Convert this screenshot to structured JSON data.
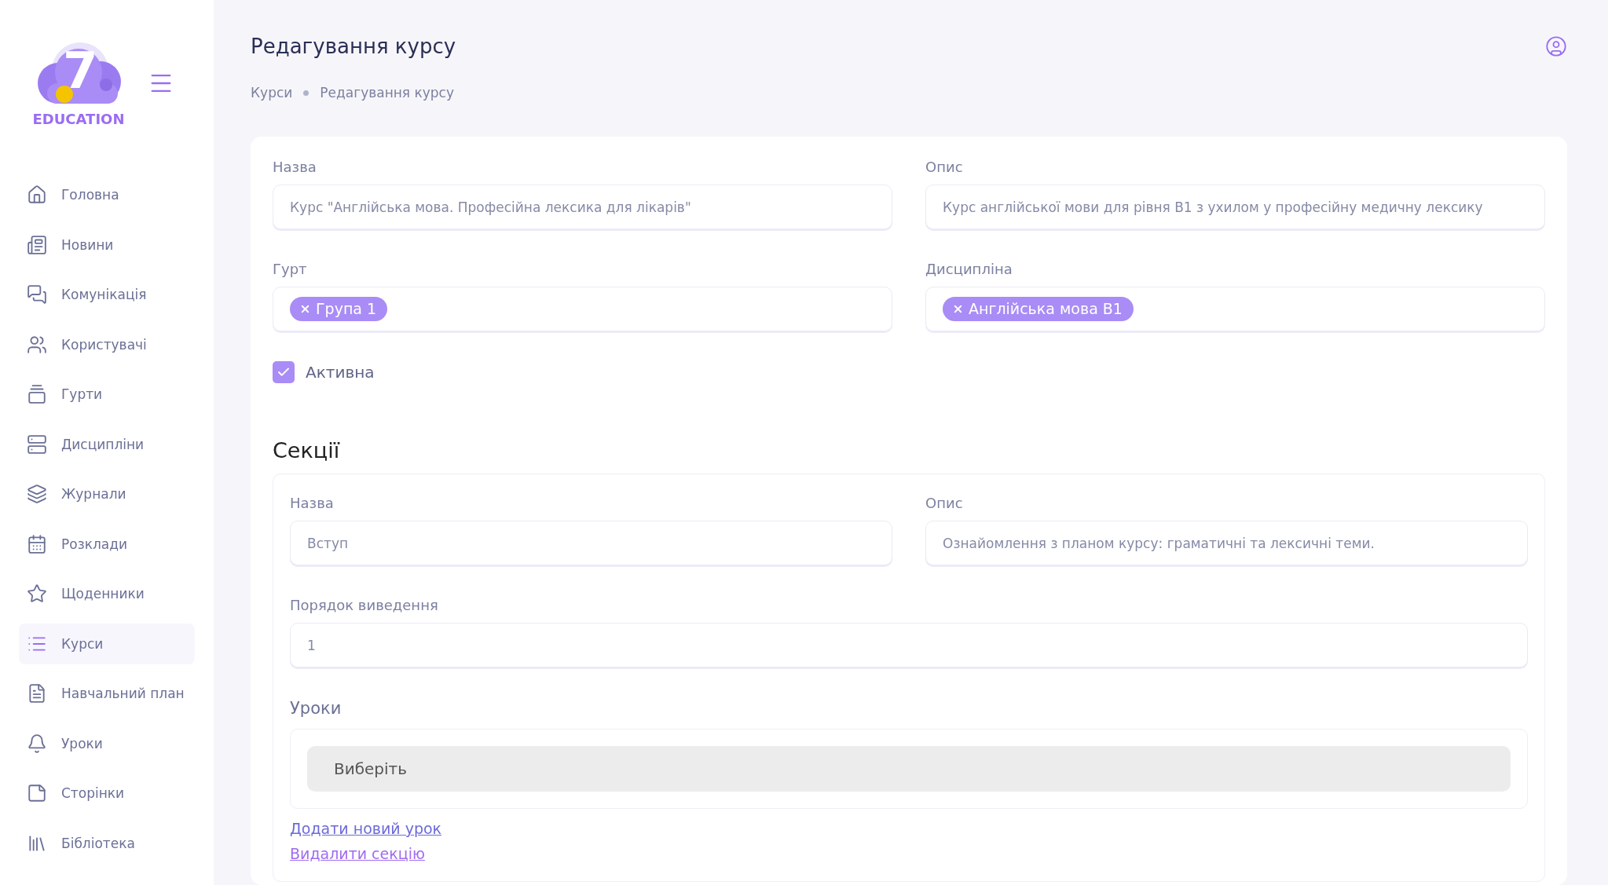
{
  "sidebar": {
    "logo": {
      "mark": "7",
      "wordmark": "EDUCATION"
    },
    "items": [
      {
        "label": "Головна",
        "selected": false
      },
      {
        "label": "Новини",
        "selected": false
      },
      {
        "label": "Комунікація",
        "selected": false
      },
      {
        "label": "Користувачі",
        "selected": false
      },
      {
        "label": "Гурти",
        "selected": false
      },
      {
        "label": "Дисципліни",
        "selected": false
      },
      {
        "label": "Журнали",
        "selected": false
      },
      {
        "label": "Розклади",
        "selected": false
      },
      {
        "label": "Щоденники",
        "selected": false
      },
      {
        "label": "Курси",
        "selected": true
      },
      {
        "label": "Навчальний план",
        "selected": false
      },
      {
        "label": "Уроки",
        "selected": false
      },
      {
        "label": "Сторінки",
        "selected": false
      },
      {
        "label": "Бібліотека",
        "selected": false
      }
    ]
  },
  "header": {
    "title": "Редагування курсу",
    "breadcrumb": [
      "Курси",
      "Редагування курсу"
    ]
  },
  "course_form": {
    "fields": [
      {
        "label": "Назва",
        "value": "Курс \"Англійська мова. Професійна лексика для лікарів\""
      },
      {
        "label": "Опис",
        "value": "Курс англійської мови для рівня В1 з ухилом у професійну медичну лексику"
      }
    ],
    "tag_fields": [
      {
        "label": "Гурт",
        "tags": [
          "Група 1"
        ]
      },
      {
        "label": "Дисципліна",
        "tags": [
          "Англійська мова В1"
        ]
      }
    ],
    "active": {
      "label": "Активна",
      "checked": true
    }
  },
  "sections": {
    "title": "Секції",
    "items": [
      {
        "fields": [
          {
            "label": "Назва",
            "value": "Вступ"
          },
          {
            "label": "Опис",
            "value": "Ознайомлення з планом курсу: граматичні та лексичні теми."
          }
        ],
        "order": {
          "label": "Порядок виведення",
          "value": "1"
        },
        "lessons": {
          "label": "Уроки",
          "placeholder": "Виберіть"
        },
        "links": [
          {
            "kind": "add",
            "label": "Додати новий урок"
          },
          {
            "kind": "delete",
            "label": "Видалити секцію"
          }
        ]
      }
    ]
  }
}
